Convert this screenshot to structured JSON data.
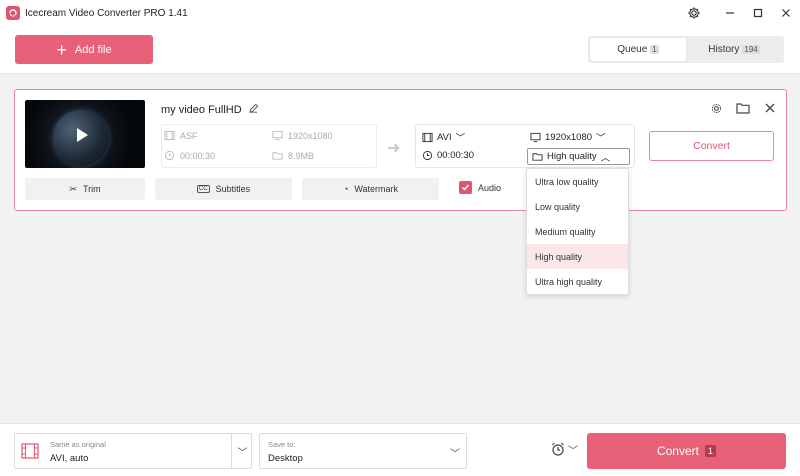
{
  "app": {
    "title": "Icecream Video Converter PRO 1.41"
  },
  "toolbar": {
    "add_file_label": "Add file",
    "tabs": [
      {
        "label": "Queue",
        "count": "1",
        "active": true
      },
      {
        "label": "History",
        "count": "194",
        "active": false
      }
    ]
  },
  "video": {
    "name": "my video FullHD",
    "source": {
      "format": "ASF",
      "resolution": "1920x1080",
      "duration": "00:00:30",
      "size": "8.9MB"
    },
    "output": {
      "format": "AVI",
      "resolution": "1920x1080",
      "duration": "00:00:30",
      "quality": "High quality"
    },
    "convert_label": "Convert",
    "actions": {
      "trim": "Trim",
      "subtitles": "Subtitles",
      "watermark": "Watermark",
      "audio": "Audio"
    }
  },
  "quality_menu": {
    "options": [
      "Ultra low quality",
      "Low quality",
      "Medium quality",
      "High quality",
      "Ultra high quality"
    ],
    "selected_index": 3
  },
  "footer": {
    "format_label": "Same as original",
    "format_value": "AVI, auto",
    "save_label": "Save to:",
    "save_value": "Desktop",
    "convert_label": "Convert",
    "convert_count": "1"
  },
  "colors": {
    "accent": "#e86178",
    "border_accent": "#e88a9b"
  }
}
